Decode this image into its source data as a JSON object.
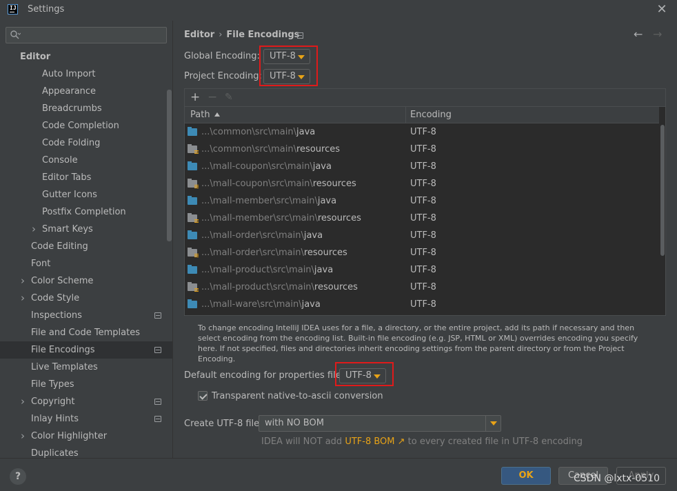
{
  "window": {
    "title": "Settings",
    "logo_text": "IJ"
  },
  "sidebar": {
    "search": {
      "value": "",
      "placeholder": ""
    },
    "root_label": "Editor",
    "items": [
      {
        "label": "Auto Import",
        "indent": 2,
        "chevron": false,
        "project_icon": false,
        "selected": false
      },
      {
        "label": "Appearance",
        "indent": 2,
        "chevron": false,
        "project_icon": false,
        "selected": false
      },
      {
        "label": "Breadcrumbs",
        "indent": 2,
        "chevron": false,
        "project_icon": false,
        "selected": false
      },
      {
        "label": "Code Completion",
        "indent": 2,
        "chevron": false,
        "project_icon": false,
        "selected": false
      },
      {
        "label": "Code Folding",
        "indent": 2,
        "chevron": false,
        "project_icon": false,
        "selected": false
      },
      {
        "label": "Console",
        "indent": 2,
        "chevron": false,
        "project_icon": false,
        "selected": false
      },
      {
        "label": "Editor Tabs",
        "indent": 2,
        "chevron": false,
        "project_icon": false,
        "selected": false
      },
      {
        "label": "Gutter Icons",
        "indent": 2,
        "chevron": false,
        "project_icon": false,
        "selected": false
      },
      {
        "label": "Postfix Completion",
        "indent": 2,
        "chevron": false,
        "project_icon": false,
        "selected": false
      },
      {
        "label": "Smart Keys",
        "indent": 2,
        "chevron": true,
        "project_icon": false,
        "selected": false
      },
      {
        "label": "Code Editing",
        "indent": 1,
        "chevron": false,
        "project_icon": false,
        "selected": false
      },
      {
        "label": "Font",
        "indent": 1,
        "chevron": false,
        "project_icon": false,
        "selected": false
      },
      {
        "label": "Color Scheme",
        "indent": 1,
        "chevron": true,
        "project_icon": false,
        "selected": false
      },
      {
        "label": "Code Style",
        "indent": 1,
        "chevron": true,
        "project_icon": false,
        "selected": false
      },
      {
        "label": "Inspections",
        "indent": 1,
        "chevron": false,
        "project_icon": true,
        "selected": false
      },
      {
        "label": "File and Code Templates",
        "indent": 1,
        "chevron": false,
        "project_icon": false,
        "selected": false
      },
      {
        "label": "File Encodings",
        "indent": 1,
        "chevron": false,
        "project_icon": true,
        "selected": true
      },
      {
        "label": "Live Templates",
        "indent": 1,
        "chevron": false,
        "project_icon": false,
        "selected": false
      },
      {
        "label": "File Types",
        "indent": 1,
        "chevron": false,
        "project_icon": false,
        "selected": false
      },
      {
        "label": "Copyright",
        "indent": 1,
        "chevron": true,
        "project_icon": true,
        "selected": false
      },
      {
        "label": "Inlay Hints",
        "indent": 1,
        "chevron": false,
        "project_icon": true,
        "selected": false
      },
      {
        "label": "Color Highlighter",
        "indent": 1,
        "chevron": true,
        "project_icon": false,
        "selected": false
      },
      {
        "label": "Duplicates",
        "indent": 1,
        "chevron": false,
        "project_icon": false,
        "selected": false
      }
    ]
  },
  "main": {
    "breadcrumb": {
      "parent": "Editor",
      "separator": "›",
      "current": "File Encodings"
    },
    "global_encoding": {
      "label": "Global Encoding:",
      "value": "UTF-8"
    },
    "project_encoding": {
      "label": "Project Encoding:",
      "value": "UTF-8"
    },
    "table": {
      "toolbar": {
        "add": "+",
        "remove": "−",
        "edit": "✎"
      },
      "columns": [
        "Path",
        "Encoding"
      ],
      "rows": [
        {
          "prefix": "...\\common\\src\\main\\",
          "leaf": "java",
          "type": "source",
          "encoding": "UTF-8"
        },
        {
          "prefix": "...\\common\\src\\main\\",
          "leaf": "resources",
          "type": "resources",
          "encoding": "UTF-8"
        },
        {
          "prefix": "...\\mall-coupon\\src\\main\\",
          "leaf": "java",
          "type": "source",
          "encoding": "UTF-8"
        },
        {
          "prefix": "...\\mall-coupon\\src\\main\\",
          "leaf": "resources",
          "type": "resources",
          "encoding": "UTF-8"
        },
        {
          "prefix": "...\\mall-member\\src\\main\\",
          "leaf": "java",
          "type": "source",
          "encoding": "UTF-8"
        },
        {
          "prefix": "...\\mall-member\\src\\main\\",
          "leaf": "resources",
          "type": "resources",
          "encoding": "UTF-8"
        },
        {
          "prefix": "...\\mall-order\\src\\main\\",
          "leaf": "java",
          "type": "source",
          "encoding": "UTF-8"
        },
        {
          "prefix": "...\\mall-order\\src\\main\\",
          "leaf": "resources",
          "type": "resources",
          "encoding": "UTF-8"
        },
        {
          "prefix": "...\\mall-product\\src\\main\\",
          "leaf": "java",
          "type": "source",
          "encoding": "UTF-8"
        },
        {
          "prefix": "...\\mall-product\\src\\main\\",
          "leaf": "resources",
          "type": "resources",
          "encoding": "UTF-8"
        },
        {
          "prefix": "...\\mall-ware\\src\\main\\",
          "leaf": "java",
          "type": "source",
          "encoding": "UTF-8"
        }
      ]
    },
    "help_text": "To change encoding IntelliJ IDEA uses for a file, a directory, or the entire project, add its path if necessary and then select encoding from the encoding list. Built-in file encoding (e.g. JSP, HTML or XML) overrides encoding you specify here. If not specified, files and directories inherit encoding settings from the parent directory or from the Project Encoding.",
    "properties_encoding": {
      "label": "Default encoding for properties files:",
      "value": "UTF-8"
    },
    "native_to_ascii": {
      "label": "Transparent native-to-ascii conversion",
      "checked": true
    },
    "create_utf8": {
      "label": "Create UTF-8 files:",
      "value": "with NO BOM"
    },
    "bom_note": {
      "before": "IDEA will NOT add ",
      "link": "UTF-8 BOM ↗",
      "after": " to every created file in UTF-8 encoding"
    }
  },
  "footer": {
    "help": "?",
    "ok": "OK",
    "cancel": "Cancel",
    "apply": "Apply"
  },
  "watermark": "CSDN @lxtx-0510",
  "colors": {
    "accent": "#e8a317",
    "highlight_box": "#e01a1a",
    "background": "#3c3f41"
  }
}
